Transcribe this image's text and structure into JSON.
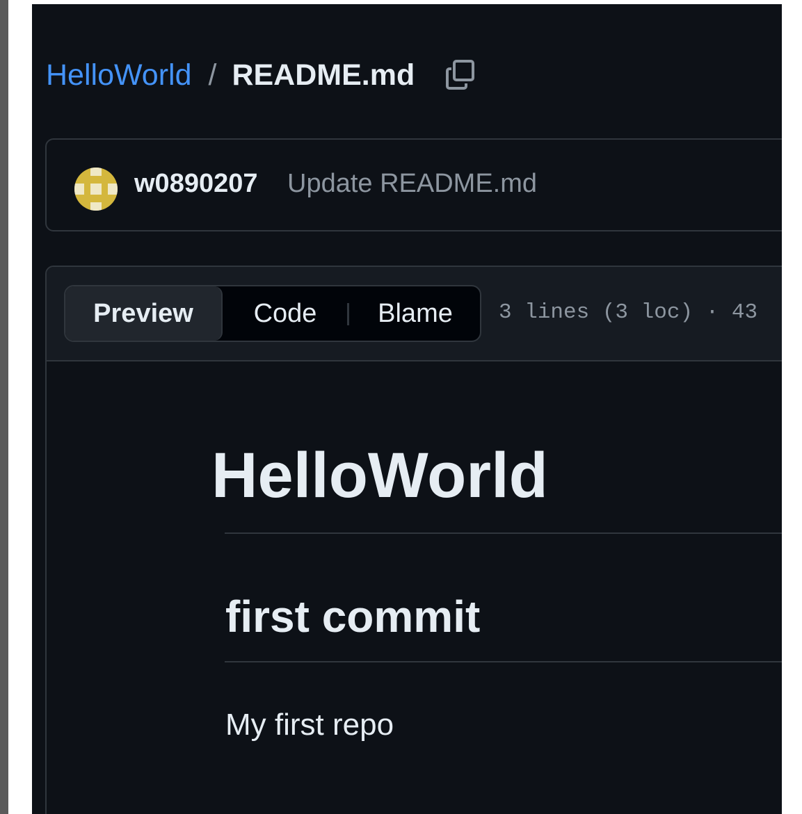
{
  "breadcrumb": {
    "repo": "HelloWorld",
    "separator": "/",
    "file": "README.md",
    "copy_icon": "copy-icon"
  },
  "commit": {
    "author": "w0890207",
    "message": "Update README.md",
    "avatar_color": "#d4b73d"
  },
  "file_view": {
    "tabs": [
      {
        "label": "Preview",
        "selected": true
      },
      {
        "label": "Code",
        "selected": false
      },
      {
        "label": "Blame",
        "selected": false
      }
    ],
    "info": "3 lines (3 loc) · 43"
  },
  "markdown": {
    "h1": "HelloWorld",
    "h2": "first commit",
    "paragraph": "My first repo"
  },
  "colors": {
    "background": "#0d1117",
    "link": "#4493f8",
    "text": "#e6edf3",
    "muted": "#8d96a0",
    "border": "#30363d"
  }
}
